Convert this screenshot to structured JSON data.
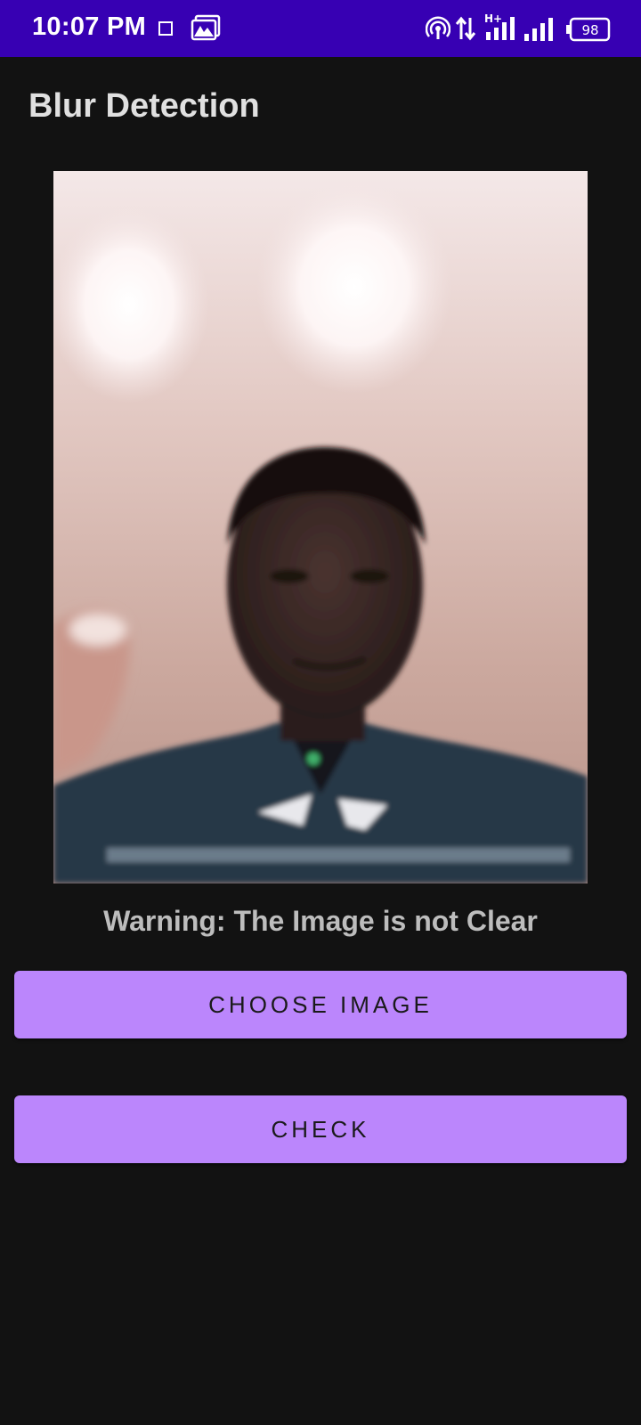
{
  "status_bar": {
    "time": "10:07 PM",
    "battery_level": "98",
    "background_color": "#3700b3",
    "icons": [
      "notification-square-icon",
      "gallery-icon",
      "hotspot-icon",
      "data-transfer-icon",
      "signal-hplus-icon",
      "signal-icon",
      "battery-icon"
    ]
  },
  "app": {
    "title": "Blur Detection"
  },
  "main": {
    "result_text": "Warning: The Image is not Clear",
    "choose_button_label": "CHOOSE IMAGE",
    "check_button_label": "CHECK",
    "accent_color": "#bb86fc",
    "background_color": "#121212"
  }
}
